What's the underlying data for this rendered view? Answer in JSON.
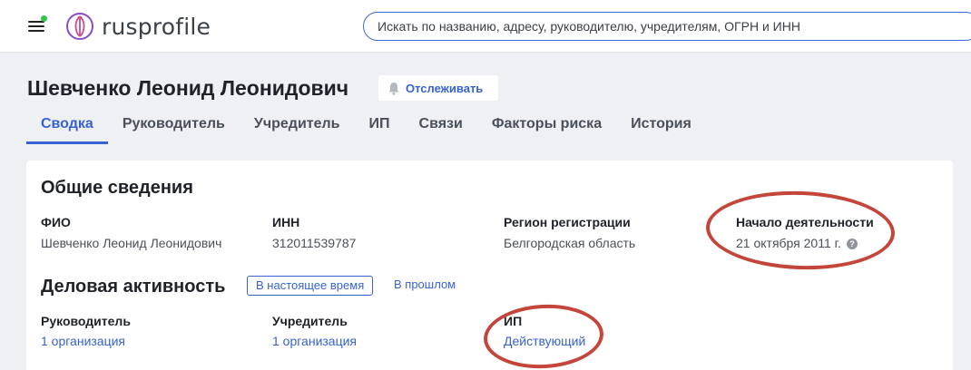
{
  "header": {
    "logo_text": "rusprofile",
    "search_placeholder": "Искать по названию, адресу, руководителю, учредителям, ОГРН и ИНН"
  },
  "person": {
    "name": "Шевченко Леонид Леонидович",
    "follow_label": "Отслеживать"
  },
  "tabs": [
    {
      "label": "Сводка",
      "active": true
    },
    {
      "label": "Руководитель"
    },
    {
      "label": "Учредитель"
    },
    {
      "label": "ИП"
    },
    {
      "label": "Связи"
    },
    {
      "label": "Факторы риска"
    },
    {
      "label": "История"
    }
  ],
  "general": {
    "heading": "Общие сведения",
    "fio_label": "ФИО",
    "fio_value": "Шевченко Леонид Леонидович",
    "inn_label": "ИНН",
    "inn_value": "312011539787",
    "region_label": "Регион регистрации",
    "region_value": "Белгородская область",
    "start_label": "Начало деятельности",
    "start_value": "21 октября 2011 г.",
    "help_icon": "?"
  },
  "business": {
    "heading": "Деловая активность",
    "toggle_current": "В настоящее время",
    "toggle_past": "В прошлом",
    "director_label": "Руководитель",
    "director_value": "1 организация",
    "founder_label": "Учредитель",
    "founder_value": "1 организация",
    "ip_label": "ИП",
    "ip_value": "Действующий"
  },
  "colors": {
    "accent": "#3762d1",
    "annotation": "#c4453a",
    "status_dot": "#2bc548"
  }
}
